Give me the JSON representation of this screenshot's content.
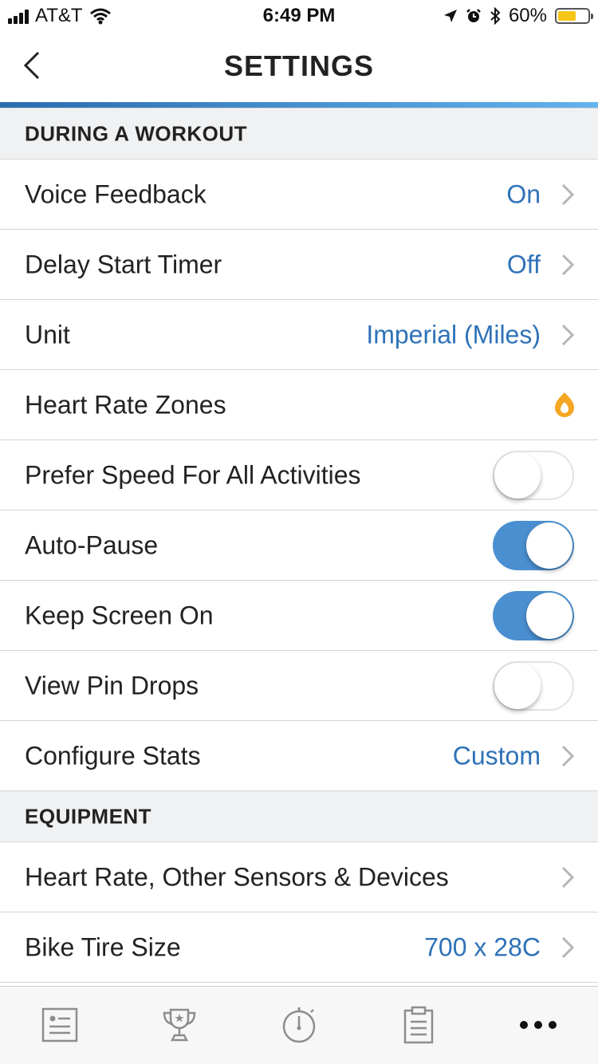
{
  "status_bar": {
    "carrier": "AT&T",
    "time": "6:49 PM",
    "battery": "60%",
    "battery_level": 0.6,
    "icons": [
      "signal-icon",
      "wifi-icon",
      "location-icon",
      "alarm-icon",
      "bluetooth-icon",
      "battery-icon"
    ]
  },
  "nav": {
    "title": "SETTINGS",
    "back_icon": "chevron-left-icon"
  },
  "colors": {
    "accent": "#2f72b8",
    "toggle_on": "#4a8fd0",
    "section_bg": "#f0f1f3",
    "heart_rate_icon": "#f5a623"
  },
  "sections": {
    "workout": {
      "header": "DURING A WORKOUT",
      "voice_feedback": {
        "label": "Voice Feedback",
        "value": "On"
      },
      "delay_start": {
        "label": "Delay Start Timer",
        "value": "Off"
      },
      "unit": {
        "label": "Unit",
        "value": "Imperial (Miles)"
      },
      "heart_rate_zones": {
        "label": "Heart Rate Zones",
        "icon": "heart-rate-zone-icon"
      },
      "prefer_speed": {
        "label": "Prefer Speed For All Activities",
        "enabled": false
      },
      "auto_pause": {
        "label": "Auto-Pause",
        "enabled": true
      },
      "keep_screen_on": {
        "label": "Keep Screen On",
        "enabled": true
      },
      "view_pin_drops": {
        "label": "View Pin Drops",
        "enabled": false
      },
      "configure_stats": {
        "label": "Configure Stats",
        "value": "Custom"
      }
    },
    "equipment": {
      "header": "EQUIPMENT",
      "sensors": {
        "label": "Heart Rate, Other Sensors & Devices"
      },
      "bike_tire": {
        "label": "Bike Tire Size",
        "value": "700 x 28C"
      }
    }
  },
  "tab_bar": {
    "tabs": [
      {
        "icon": "feed-icon"
      },
      {
        "icon": "trophy-icon"
      },
      {
        "icon": "stopwatch-icon"
      },
      {
        "icon": "clipboard-icon"
      },
      {
        "icon": "more-icon",
        "selected": true
      }
    ]
  }
}
